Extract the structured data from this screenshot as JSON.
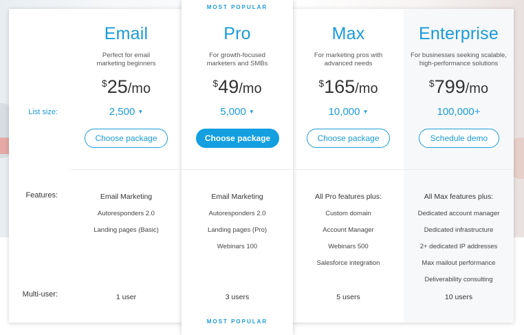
{
  "labels": {
    "list_size": "List size:",
    "features": "Features:",
    "multi_user": "Multi-user:"
  },
  "badge": "MOST POPULAR",
  "plans": [
    {
      "name": "Email",
      "description": "Perfect for email marketing beginners",
      "currency": "$",
      "price": "25",
      "period": "/mo",
      "list_size": "2,500",
      "button": "Choose package",
      "features_title": "Email Marketing",
      "features": [
        "Autoresponders 2.0",
        "Landing pages (Basic)"
      ],
      "users": "1 user"
    },
    {
      "name": "Pro",
      "description": "For growth-focused marketers and SMBs",
      "currency": "$",
      "price": "49",
      "period": "/mo",
      "list_size": "5,000",
      "button": "Choose package",
      "features_title": "Email Marketing",
      "features": [
        "Autoresponders 2.0",
        "Landing pages (Pro)",
        "Webinars 100"
      ],
      "users": "3 users"
    },
    {
      "name": "Max",
      "description": "For marketing pros with advanced needs",
      "currency": "$",
      "price": "165",
      "period": "/mo",
      "list_size": "10,000",
      "button": "Choose package",
      "features_title": "All Pro features plus:",
      "features": [
        "Custom domain",
        "Account Manager",
        "Webinars 500",
        "Salesforce integration"
      ],
      "users": "5 users"
    },
    {
      "name": "Enterprise",
      "description": "For businesses seeking scalable, high-performance solutions",
      "currency": "$",
      "price": "799",
      "period": "/mo",
      "list_size": "100,000+",
      "button": "Schedule demo",
      "features_title": "All Max features plus:",
      "features": [
        "Dedicated account manager",
        "Dedicated infrastructure",
        "2+ dedicated IP addresses",
        "Max mailout performance",
        "Deliverability consulting"
      ],
      "users": "10 users"
    }
  ],
  "colors": {
    "accent": "#1a9bd7",
    "primary_button": "#139fe0",
    "enterprise_bg": "#f6f8fa"
  },
  "icons": {
    "dropdown": "caret-down-icon"
  }
}
